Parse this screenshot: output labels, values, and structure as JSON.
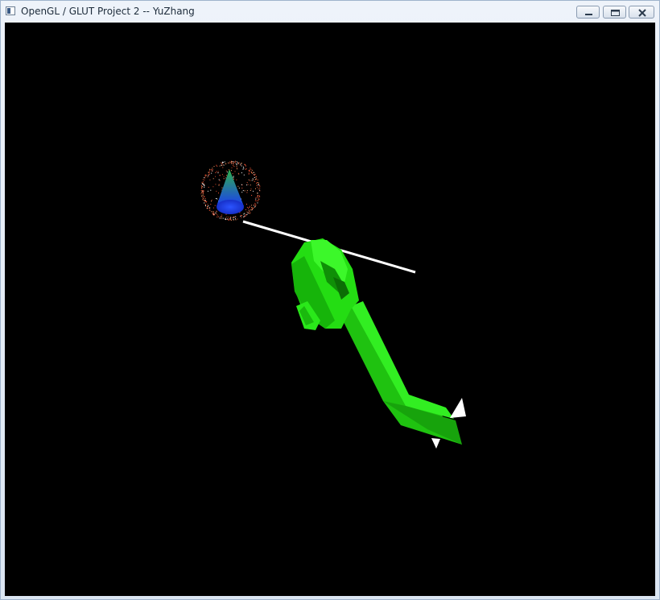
{
  "window": {
    "title": "OpenGL / GLUT Project 2 -- YuZhang",
    "icons": {
      "app": "app-window-icon",
      "minimize": "minimize-icon",
      "maximize": "maximize-icon",
      "close": "close-icon"
    }
  },
  "scene": {
    "background": "#000000",
    "helicopter_color": "#22dd11",
    "cone_gradient": [
      "#2fb24a",
      "#1b3df2"
    ],
    "particle_color": "#ff5a3a",
    "rotor_color": "#ffffff"
  }
}
